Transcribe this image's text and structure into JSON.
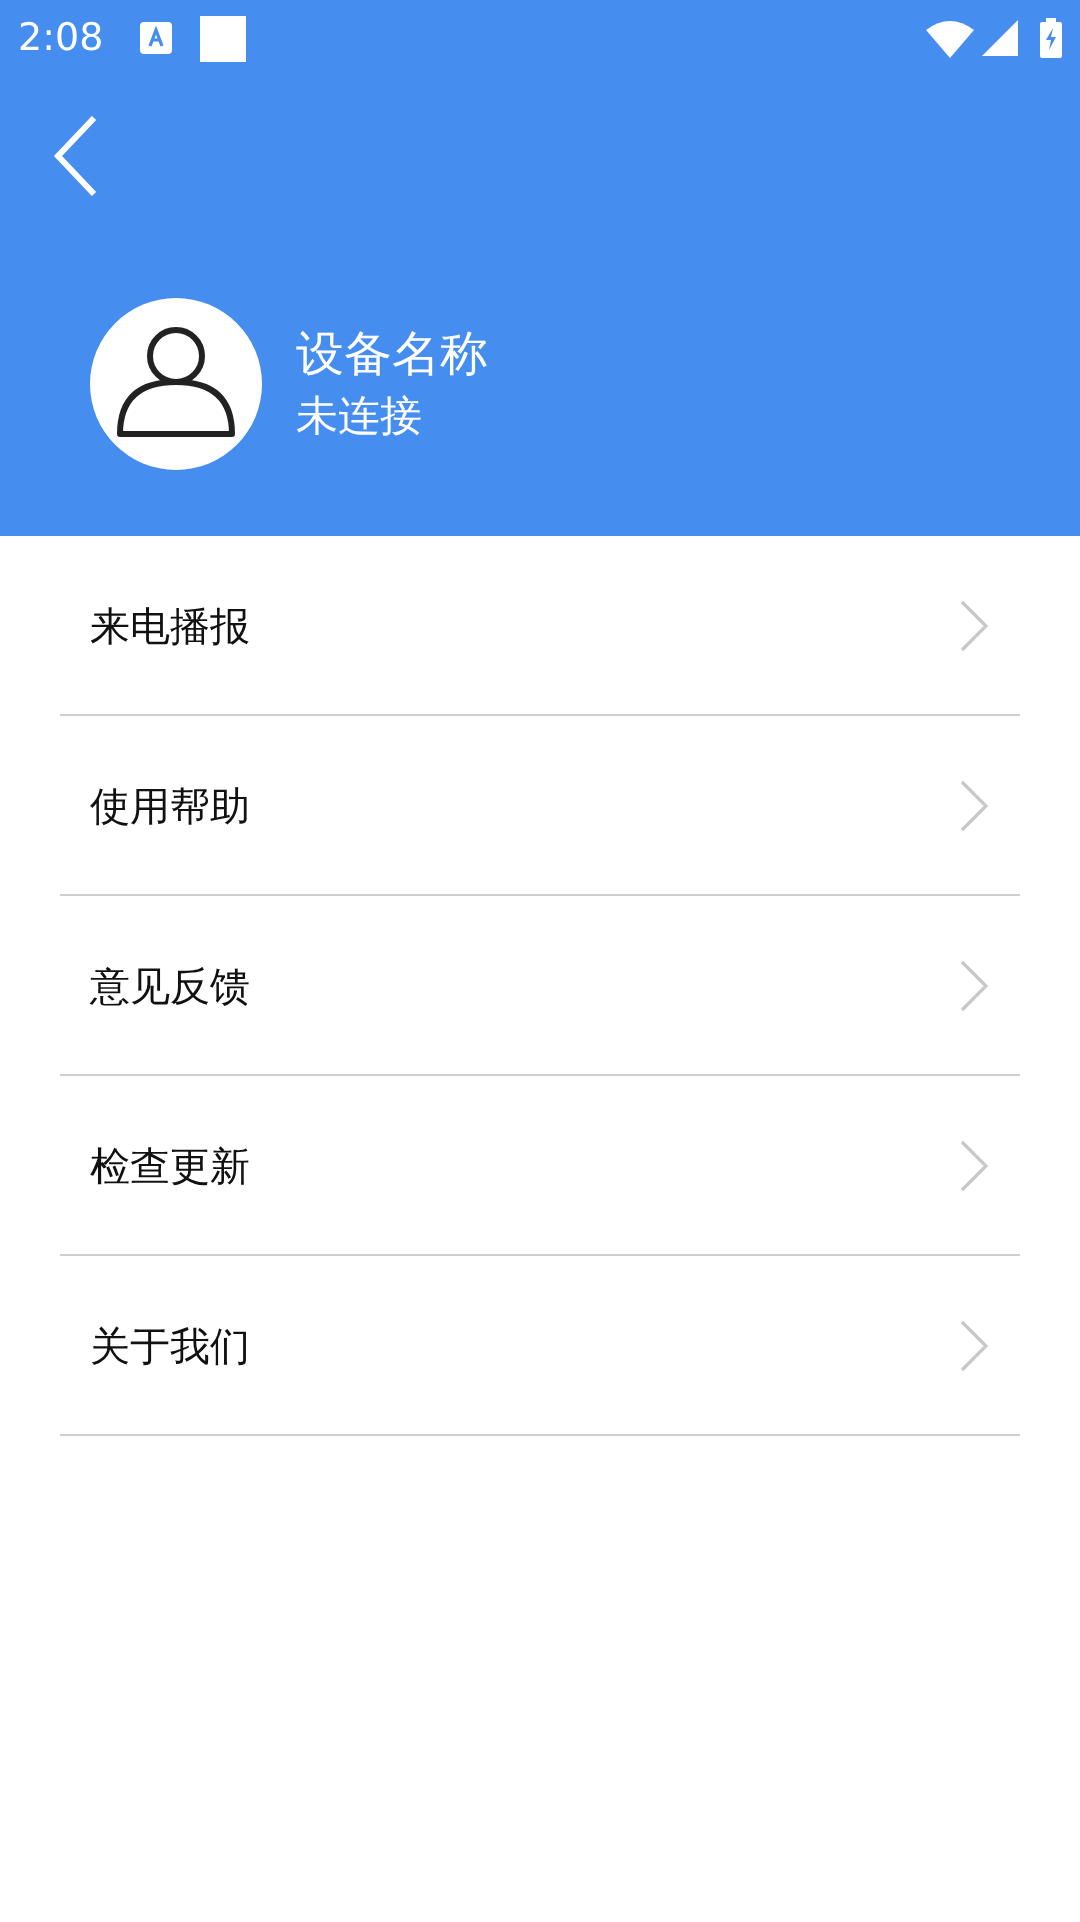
{
  "status_bar": {
    "time": "2:08"
  },
  "profile": {
    "device_name": "设备名称",
    "status": "未连接"
  },
  "menu": [
    {
      "label": "来电播报"
    },
    {
      "label": "使用帮助"
    },
    {
      "label": "意见反馈"
    },
    {
      "label": "检查更新"
    },
    {
      "label": "关于我们"
    }
  ]
}
